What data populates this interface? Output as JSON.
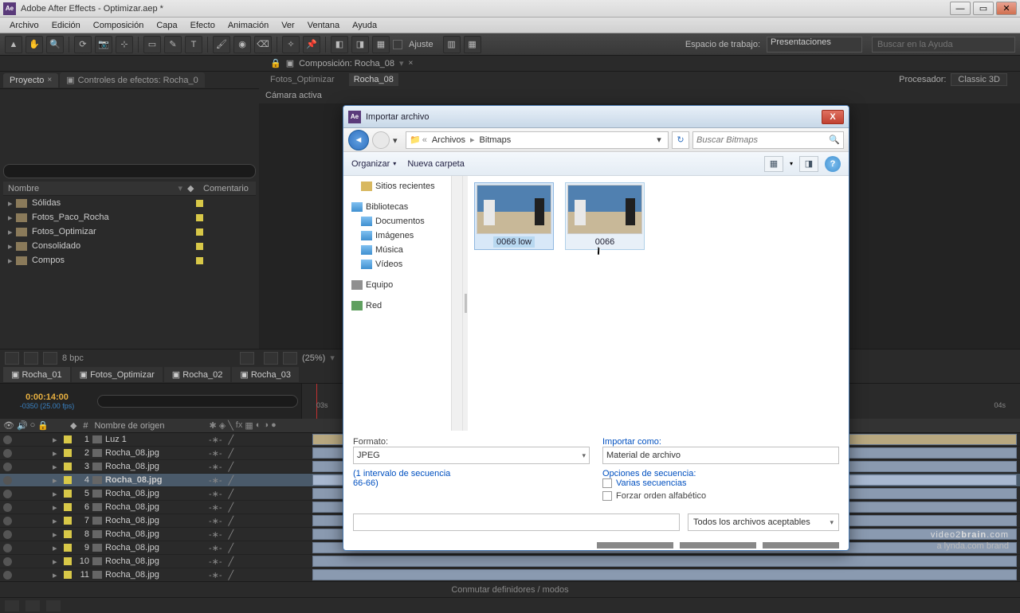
{
  "title": "Adobe After Effects - Optimizar.aep *",
  "menu": [
    "Archivo",
    "Edición",
    "Composición",
    "Capa",
    "Efecto",
    "Animación",
    "Ver",
    "Ventana",
    "Ayuda"
  ],
  "toolbar": {
    "ajuste": "Ajuste",
    "workspace_label": "Espacio de trabajo:",
    "workspace_value": "Presentaciones",
    "search_placeholder": "Buscar en la Ayuda"
  },
  "project": {
    "tab1": "Proyecto",
    "tab2": "Controles de efectos: Rocha_0",
    "cols": {
      "name": "Nombre",
      "comment": "Comentario"
    },
    "items": [
      "Sólidas",
      "Fotos_Paco_Rocha",
      "Fotos_Optimizar",
      "Consolidado",
      "Compos"
    ],
    "bpc": "8 bpc"
  },
  "comp": {
    "label_bar": "Composición: Rocha_08",
    "subtabs": [
      "Fotos_Optimizar",
      "Rocha_08"
    ],
    "renderer_label": "Procesador:",
    "renderer_value": "Classic 3D",
    "camera": "Cámara activa",
    "zoom": "(25%)"
  },
  "timeline": {
    "tabs": [
      "Rocha_01",
      "Fotos_Optimizar",
      "Rocha_02",
      "Rocha_03"
    ],
    "time": "0:00:14:00",
    "time_sub": "-0350 (25.00 fps)",
    "col_num": "#",
    "col_name": "Nombre de origen",
    "layers": [
      {
        "n": 1,
        "name": "Luz 1",
        "light": true
      },
      {
        "n": 2,
        "name": "Rocha_08.jpg"
      },
      {
        "n": 3,
        "name": "Rocha_08.jpg"
      },
      {
        "n": 4,
        "name": "Rocha_08.jpg",
        "selected": true
      },
      {
        "n": 5,
        "name": "Rocha_08.jpg"
      },
      {
        "n": 6,
        "name": "Rocha_08.jpg"
      },
      {
        "n": 7,
        "name": "Rocha_08.jpg"
      },
      {
        "n": 8,
        "name": "Rocha_08.jpg"
      },
      {
        "n": 9,
        "name": "Rocha_08.jpg"
      },
      {
        "n": 10,
        "name": "Rocha_08.jpg"
      },
      {
        "n": 11,
        "name": "Rocha_08.jpg"
      }
    ],
    "ruler": [
      "03s",
      "04s"
    ],
    "footer": "Conmutar definidores / modos"
  },
  "dialog": {
    "title": "Importar archivo",
    "breadcrumb": [
      "Archivos",
      "Bitmaps"
    ],
    "search_placeholder": "Buscar Bitmaps",
    "organize": "Organizar",
    "newfolder": "Nueva carpeta",
    "tree": {
      "recent": "Sitios recientes",
      "libs": "Bibliotecas",
      "docs": "Documentos",
      "images": "Imágenes",
      "music": "Música",
      "videos": "Vídeos",
      "computer": "Equipo",
      "network": "Red"
    },
    "files": [
      {
        "name": "0066 low",
        "selected": true
      },
      {
        "name": "0066",
        "hover": true
      }
    ],
    "format_label": "Formato:",
    "format_value": "JPEG",
    "seq_note1": "(1 intervalo de secuencia",
    "seq_note2": "66-66)",
    "import_as_label": "Importar como:",
    "import_as_value": "Material de archivo",
    "seq_options": "Opciones de secuencia:",
    "multi_seq": "Varias secuencias",
    "force_alpha": "Forzar orden alfabético",
    "filetype": "Todos los archivos aceptables"
  },
  "watermark": {
    "line1a": "video2",
    "line1b": "brain",
    "line1c": ".com",
    "line2": "a lynda.com brand"
  }
}
